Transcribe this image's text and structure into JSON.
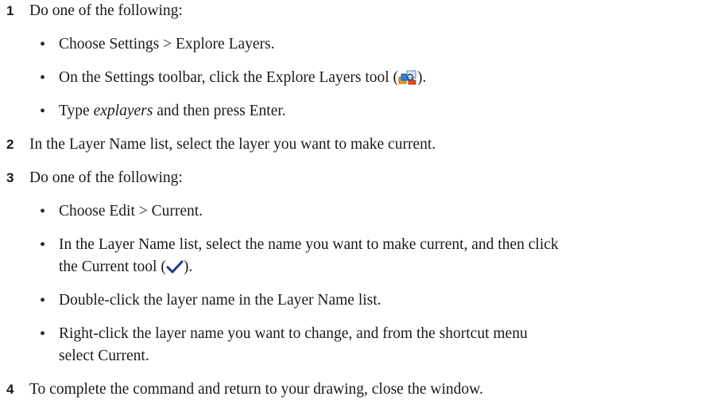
{
  "steps": [
    {
      "number": "1",
      "text": "Do one of the following:"
    },
    {
      "number": "2",
      "text": "In the Layer Name list, select the layer you want to make current."
    },
    {
      "number": "3",
      "text": "Do one of the following:"
    },
    {
      "number": "4",
      "text": "To complete the command and return to your drawing, close the window."
    }
  ],
  "step1_bullets": {
    "b1": "Choose Settings > Explore Layers.",
    "b2_before": "On the Settings toolbar, click the Explore Layers tool (",
    "b2_after": ").",
    "b3_italic": "explayers",
    "b3_prefix": "Type ",
    "b3_suffix": " and then press Enter."
  },
  "step3_bullets": {
    "b1": "Choose Edit > Current.",
    "b2_line1": "In the Layer Name list, select the name you want to make current, and then click",
    "b2_line2_before": "the Current tool (",
    "b2_line2_after": ").",
    "b3": "Double-click the layer name in the Layer Name list.",
    "b4_line1": "Right-click the layer name you want to change, and from the shortcut menu",
    "b4_line2": "select Current."
  },
  "bullet_glyph": "•",
  "icons": {
    "explore_layers": "explore-layers-icon",
    "current": "checkmark-icon"
  }
}
